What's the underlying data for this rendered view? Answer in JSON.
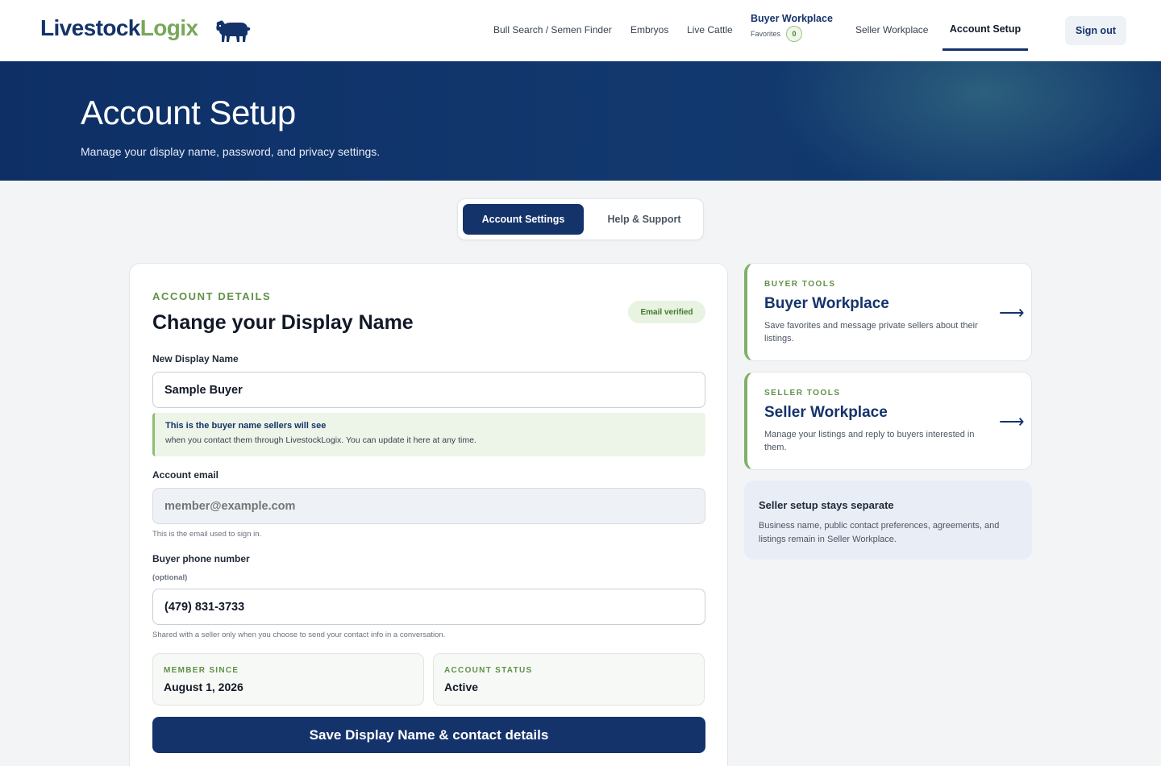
{
  "header": {
    "logo_part1": "Livestock",
    "logo_part2": "Logix",
    "nav": {
      "bull_search": "Bull Search / Semen Finder",
      "embryos": "Embryos",
      "live_cattle": "Live Cattle",
      "buyer_workplace": "Buyer Workplace",
      "favorites_label": "Favorites",
      "favorites_count": "0",
      "seller_workplace": "Seller Workplace",
      "account_setup": "Account Setup"
    },
    "sign_out": "Sign out"
  },
  "hero": {
    "title": "Account Setup",
    "subtitle": "Manage your display name, password, and privacy settings."
  },
  "tabs": {
    "active": "Account Settings",
    "inactive": "Help & Support"
  },
  "account": {
    "eyebrow": "ACCOUNT DETAILS",
    "title": "Change your Display Name",
    "verified_badge": "Email verified",
    "display_name_label": "New Display Name",
    "display_name_value": "Sample Buyer",
    "note_strong": "This is the buyer name sellers will see",
    "note_text": "when you contact them through LivestockLogix. You can update it here at any time.",
    "email_label": "Account email",
    "email_placeholder": "member@example.com",
    "email_helper": "This is the email used to sign in.",
    "phone_label": "Buyer phone number",
    "phone_optional": "(optional)",
    "phone_value": "(479) 831-3733",
    "phone_helper": "Shared with a seller only when you choose to send your contact info in a conversation.",
    "member_since_label": "MEMBER SINCE",
    "member_since_value": "August 1, 2026",
    "status_label": "ACCOUNT STATUS",
    "status_value": "Active",
    "save_label": "Save Display Name & contact details"
  },
  "sidebar": {
    "buyer": {
      "eyebrow": "BUYER TOOLS",
      "title": "Buyer Workplace",
      "desc": "Save favorites and message private sellers about their listings.",
      "arrow": "⟶"
    },
    "seller": {
      "eyebrow": "SELLER TOOLS",
      "title": "Seller Workplace",
      "desc": "Manage your listings and reply to buyers interested in them.",
      "arrow": "⟶"
    },
    "info": {
      "title": "Seller setup stays separate",
      "text": "Business name, public contact preferences, agreements, and listings remain in Seller Workplace."
    }
  },
  "colors": {
    "brand_navy": "#15336b",
    "brand_green": "#78a85a",
    "accent_green": "#5f9146"
  },
  "icons": {
    "logo_mark": "bull-icon",
    "card_arrow": "arrow-right-icon"
  }
}
